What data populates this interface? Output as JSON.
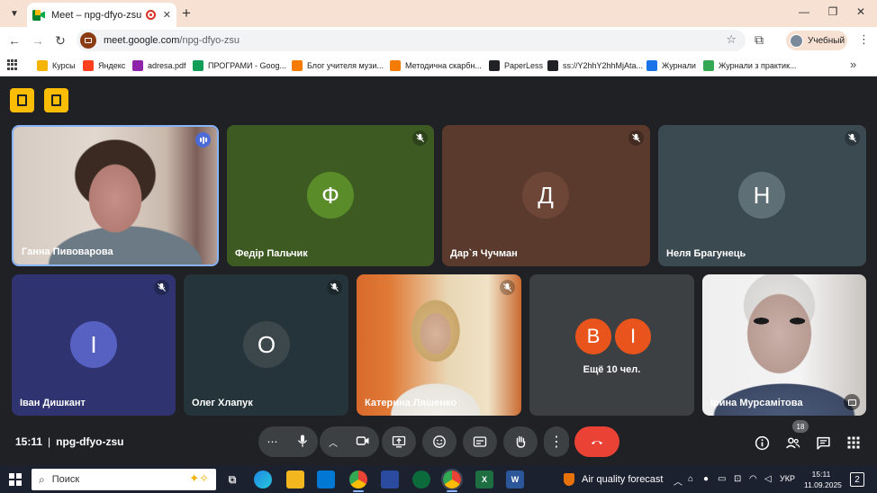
{
  "browser": {
    "tab_title": "Meet – npg-dfyo-zsu",
    "tab_close": "✕",
    "new_tab": "+",
    "minimize": "—",
    "restore": "❐",
    "close": "✕",
    "url_host": "meet.google.com",
    "url_path": "/npg-dfyo-zsu",
    "profile_label": "Учебный"
  },
  "bookmarks": [
    {
      "label": "Курсы",
      "color": "#f4b400"
    },
    {
      "label": "Яндекс",
      "color": "#fc3f1d"
    },
    {
      "label": "adresa.pdf",
      "color": "#8e24aa"
    },
    {
      "label": "ПРОГРАМИ - Goog...",
      "color": "#0f9d58"
    },
    {
      "label": "Блог учителя музи...",
      "color": "#f57c00"
    },
    {
      "label": "Методична скарбн...",
      "color": "#f57c00"
    },
    {
      "label": "PaperLess",
      "color": "#202124"
    },
    {
      "label": "ss://Y2hhY2hhMjAta...",
      "color": "#202124"
    },
    {
      "label": "Журнали",
      "color": "#1a73e8"
    },
    {
      "label": "Журнали з практик...",
      "color": "#34a853"
    }
  ],
  "meeting": {
    "time": "15:11",
    "code": "npg-dfyo-zsu",
    "separator": "|",
    "participants_count": "18"
  },
  "participants": [
    {
      "name": "Ганна Пивоварова",
      "initial": "",
      "video": true
    },
    {
      "name": "Федір Пальчик",
      "initial": "Ф",
      "avatar_color": "#5b8c2a",
      "tile_color": "#3d5a22"
    },
    {
      "name": "Дар`я Чучман",
      "initial": "Д",
      "avatar_color": "#6d4637",
      "tile_color": "#5a3a2c"
    },
    {
      "name": "Неля Брагунець",
      "initial": "Н",
      "avatar_color": "#5f6f76",
      "tile_color": "#3a4a50"
    },
    {
      "name": "Іван Дишкант",
      "initial": "І",
      "avatar_color": "#5661c2",
      "tile_color": "#2f3470"
    },
    {
      "name": "Олег Хлапук",
      "initial": "О",
      "avatar_color": "#3c474c",
      "tile_color": "#24343a"
    },
    {
      "name": "Катерина Ляшенко",
      "initial": "",
      "video": true
    },
    {
      "name": "Ірина Мурсамітова",
      "initial": "",
      "video": true
    }
  ],
  "more_tile": {
    "label": "Ещё 10 чел.",
    "avatars": [
      {
        "initial": "В",
        "color": "#e8541c"
      },
      {
        "initial": "І",
        "color": "#e8541c"
      }
    ]
  },
  "taskbar": {
    "search_placeholder": "Поиск",
    "weather": "Air quality forecast",
    "language": "УКР",
    "time": "15:11",
    "date": "11.09.2025",
    "notifications": "2"
  }
}
